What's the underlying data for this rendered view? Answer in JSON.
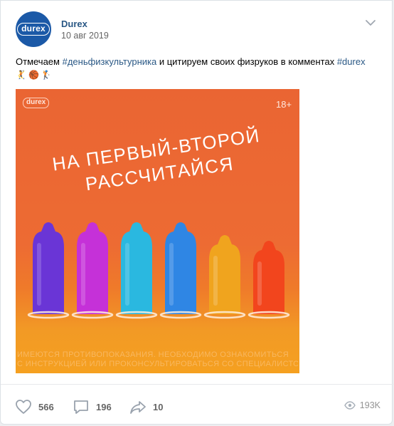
{
  "post": {
    "author": "Durex",
    "avatar_logo_text": "durex",
    "date": "10 авг 2019",
    "text_before": "Отмечаем ",
    "hashtag_1": "#деньфизкультурника",
    "text_middle": " и цитируем своих физруков в комментах ",
    "hashtag_2": "#durex",
    "emojis": [
      "🤾",
      "🏀",
      "🏌"
    ]
  },
  "image": {
    "logo_text": "durex",
    "age_rating": "18+",
    "headline_line1": "НА ПЕРВЫЙ-ВТОРОЙ",
    "headline_line2": "РАССЧИТАЙСЯ",
    "disclaimer_line1": "ИМЕЮТСЯ ПРОТИВОПОКАЗАНИЯ. НЕОБХОДИМО ОЗНАКОМИТЬСЯ",
    "disclaimer_line2": "С ИНСТРУКЦИЕЙ ИЛИ ПРОКОНСУЛЬТИРОВАТЬСЯ СО СПЕЦИАЛИСТОМ",
    "condom_colors": [
      "#6a35d6",
      "#c531d8",
      "#2ab8e0",
      "#2f86e4",
      "#f0a41e",
      "#f2451d"
    ]
  },
  "footer": {
    "likes": "566",
    "comments": "196",
    "shares": "10",
    "views": "193K"
  },
  "colors": {
    "link": "#2a5885",
    "avatar_bg": "#1b59a7",
    "muted": "#656565"
  },
  "icons": {
    "menu": "chevron-down-icon",
    "like": "heart-icon",
    "comment": "comment-icon",
    "share": "share-arrow-icon",
    "views": "eye-icon"
  }
}
